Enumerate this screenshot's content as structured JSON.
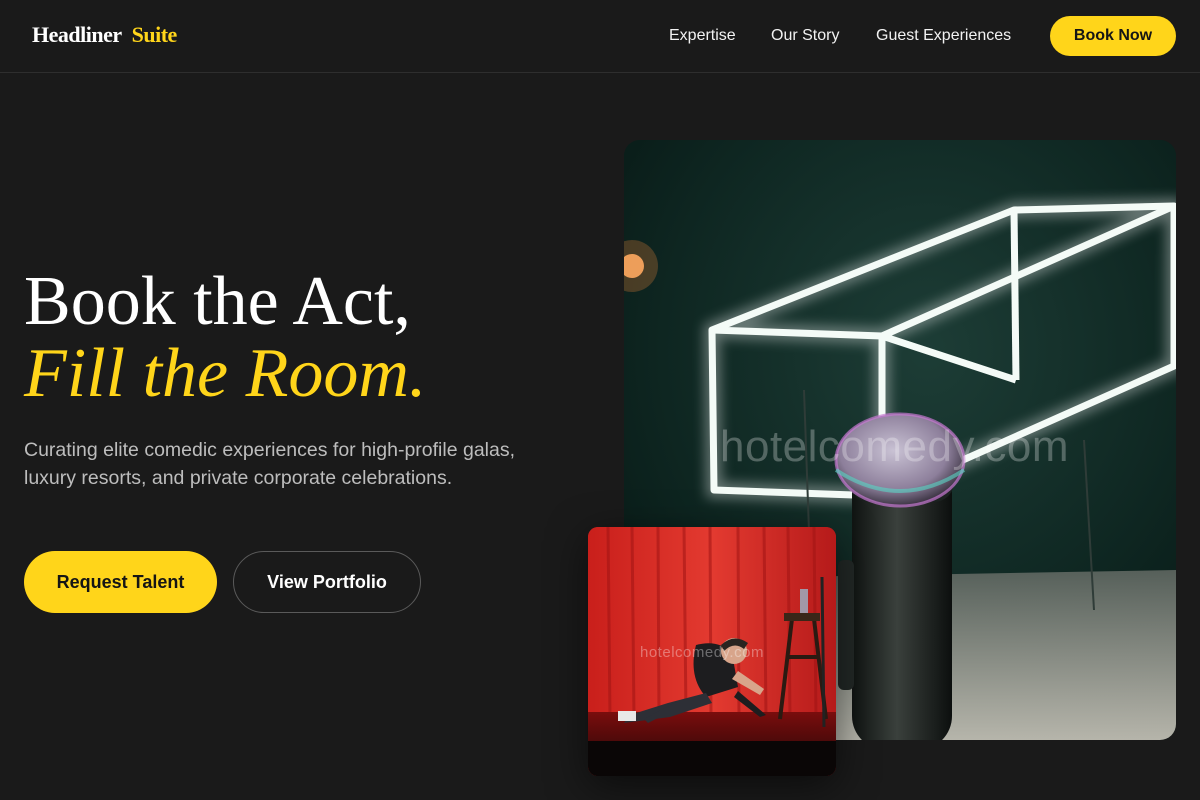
{
  "nav": {
    "logo_primary": "Headliner",
    "logo_accent": "Suite",
    "links": [
      "Expertise",
      "Our Story",
      "Guest Experiences"
    ],
    "cta_label": "Book Now"
  },
  "hero": {
    "title_line1": "Book the Act,",
    "title_line2": "Fill the Room.",
    "subtitle": "Curating elite comedic experiences for high-profile galas, luxury resorts, and private corporate celebrations.",
    "primary_button": "Request Talent",
    "secondary_button": "View Portfolio"
  },
  "images": {
    "main": {
      "watermark": "hotelcomedy.com",
      "icon": "microphone-stage-photo"
    },
    "secondary": {
      "watermark": "hotelcomedy.com",
      "icon": "comedian-on-stage-photo"
    }
  },
  "colors": {
    "background": "#1a1a1a",
    "accent": "#ffd51a",
    "text_primary": "#ffffff",
    "text_secondary": "#bdbdbd"
  }
}
